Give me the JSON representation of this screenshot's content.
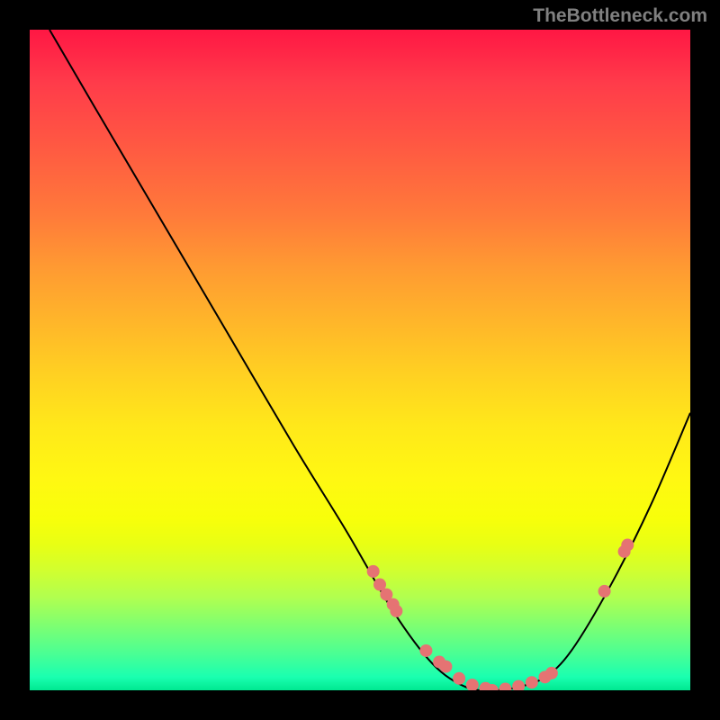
{
  "watermark": "TheBottleneck.com",
  "chart_data": {
    "type": "line",
    "title": "",
    "xlabel": "",
    "ylabel": "",
    "xlim": [
      0,
      100
    ],
    "ylim": [
      0,
      100
    ],
    "grid": false,
    "series": [
      {
        "name": "bottleneck-curve",
        "x": [
          3,
          10,
          20,
          30,
          40,
          48,
          55,
          61,
          66,
          70,
          74,
          78,
          82,
          88,
          94,
          100
        ],
        "y": [
          100,
          88,
          71,
          54,
          37,
          24,
          12,
          4,
          0.5,
          0,
          0.5,
          2,
          6,
          16,
          28,
          42
        ]
      }
    ],
    "highlighted_points": {
      "name": "marker-dots",
      "color": "#e57373",
      "x": [
        52,
        53,
        54,
        55,
        55.5,
        60,
        62,
        63,
        65,
        67,
        69,
        70,
        72,
        74,
        76,
        78,
        79,
        87,
        90,
        90.5
      ],
      "y": [
        18,
        16,
        14.5,
        13,
        12,
        6,
        4.3,
        3.6,
        1.8,
        0.8,
        0.3,
        0,
        0.2,
        0.6,
        1.2,
        2,
        2.6,
        15,
        21,
        22
      ]
    },
    "background_gradient": {
      "top": "#ff1744",
      "mid": "#ffee00",
      "bottom": "#00e890"
    }
  }
}
